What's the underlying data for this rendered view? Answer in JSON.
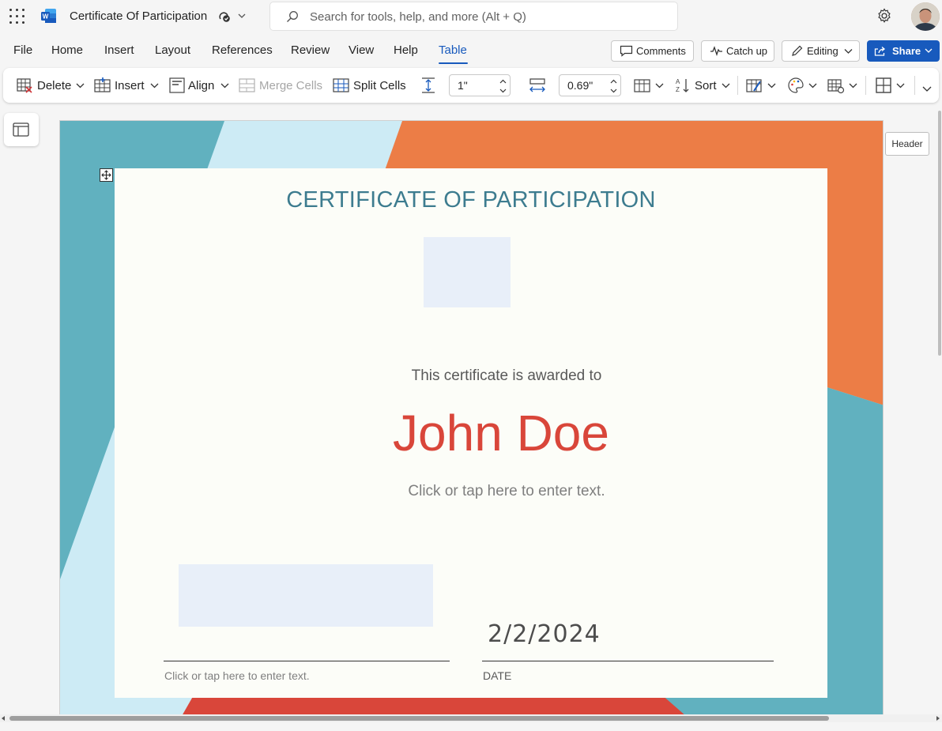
{
  "app": {
    "doc_title": "Certificate Of Participation",
    "search_placeholder": "Search for tools, help, and more (Alt + Q)"
  },
  "menu": {
    "tabs": [
      "File",
      "Home",
      "Insert",
      "Layout",
      "References",
      "Review",
      "View",
      "Help",
      "Table"
    ],
    "active_tab": "Table",
    "comments_label": "Comments",
    "catchup_label": "Catch up",
    "editing_label": "Editing",
    "share_label": "Share"
  },
  "ribbon": {
    "delete_label": "Delete",
    "insert_label": "Insert",
    "align_label": "Align",
    "merge_label": "Merge Cells",
    "split_label": "Split Cells",
    "height_value": "1\"",
    "width_value": "0.69\"",
    "sort_label": "Sort"
  },
  "document": {
    "header_tag": "Header",
    "title": "CERTIFICATE OF PARTICIPATION",
    "awarded_text": "This certificate is awarded to",
    "recipient": "John Doe",
    "placeholder_text": "Click or tap here to enter text.",
    "date_value": "2/2/2024",
    "signature_placeholder": "Click or tap here to enter text.",
    "date_label": "DATE"
  },
  "colors": {
    "accent": "#185abd",
    "title_color": "#3d7c8f",
    "name_color": "#d9463a",
    "teal": "#61b1bf",
    "orange": "#ec7d46",
    "light_blue": "#cdebf5",
    "red": "#d9463a"
  }
}
